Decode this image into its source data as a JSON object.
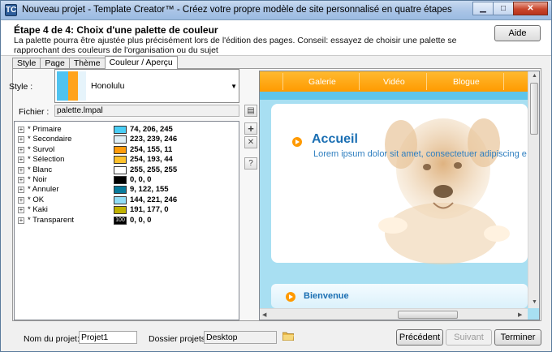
{
  "window": {
    "app_icon_text": "TC",
    "title": "Nouveau projet - Template Creator™ - Créez votre propre modèle de site personnalisé en quatre étapes",
    "minimize": "▁",
    "maximize": "□",
    "close": "✕"
  },
  "header": {
    "step_title": "Étape 4 de 4: Choix d'une palette de couleur",
    "description": "La palette pourra être ajustée plus précisément lors de l'édition des pages. Conseil: essayez de choisir une palette se rapprochant des couleurs de l'organisation ou du sujet",
    "help_label": "Aide"
  },
  "tabs": [
    "Style",
    "Page",
    "Thème",
    "Couleur / Aperçu"
  ],
  "active_tab": "Couleur / Aperçu",
  "style": {
    "label": "Style :",
    "selected": "Honolulu"
  },
  "file": {
    "label": "Fichier :",
    "value": "palette.lmpal"
  },
  "palette": [
    {
      "name": "* Primaire",
      "color": "#4ACEF5",
      "value": "74, 206, 245"
    },
    {
      "name": "* Secondaire",
      "color": "#DFEFF6",
      "value": "223, 239, 246"
    },
    {
      "name": "* Survol",
      "color": "#FE9B0B",
      "value": "254, 155, 11"
    },
    {
      "name": "* Sélection",
      "color": "#FEC12C",
      "value": "254, 193, 44"
    },
    {
      "name": "* Blanc",
      "color": "#FFFFFF",
      "value": "255, 255, 255"
    },
    {
      "name": "* Noir",
      "color": "#000000",
      "value": "0, 0, 0"
    },
    {
      "name": "* Annuler",
      "color": "#097A9B",
      "value": "9, 122, 155"
    },
    {
      "name": "* OK",
      "color": "#90DDF6",
      "value": "144, 221, 246"
    },
    {
      "name": "* Kaki",
      "color": "#BFB100",
      "value": "191, 177, 0"
    },
    {
      "name": "* Transparent",
      "color": "#000000",
      "value": "0, 0, 0",
      "swatch_text": "100"
    }
  ],
  "side_buttons": {
    "edit": "▤",
    "add": "+",
    "delete": "✕",
    "help": "?"
  },
  "preview": {
    "nav": [
      "Galerie",
      "Vidéo",
      "Blogue"
    ],
    "heading": "Accueil",
    "text": "Lorem ipsum dolor sit amet, consectetuer adipiscing e",
    "section": "Bienvenue"
  },
  "footer": {
    "project_name_label": "Nom du projet:",
    "project_name": "Projet1",
    "folder_label": "Dossier projets:",
    "folder": "Desktop",
    "previous": "Précédent",
    "next": "Suivant",
    "finish": "Terminer"
  }
}
